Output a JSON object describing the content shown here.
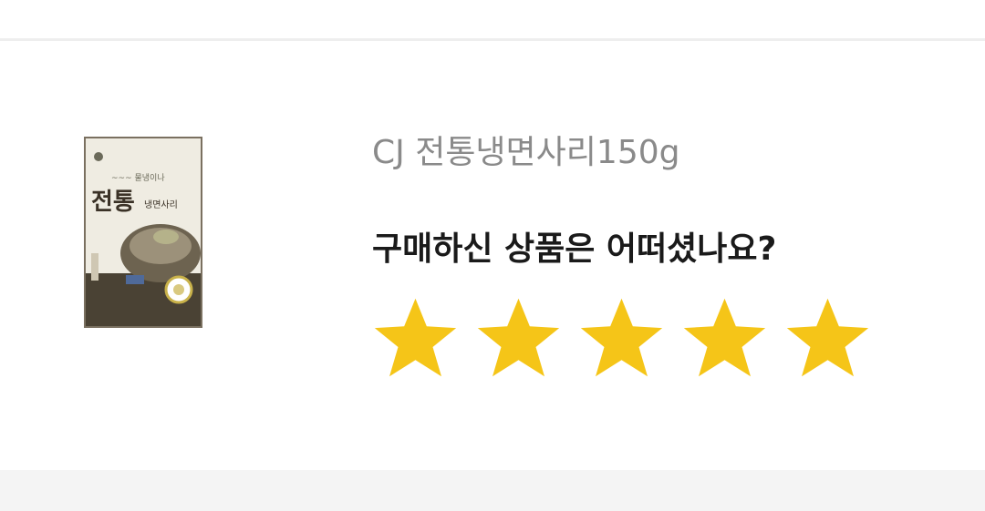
{
  "product": {
    "name": "CJ 전통냉면사리150g",
    "thumbnail_icon": "noodle-package-image"
  },
  "review": {
    "question": "구매하신 상품은 어떠셨나요?",
    "rating": 5,
    "max_rating": 5,
    "star_color": "#F5C518"
  }
}
